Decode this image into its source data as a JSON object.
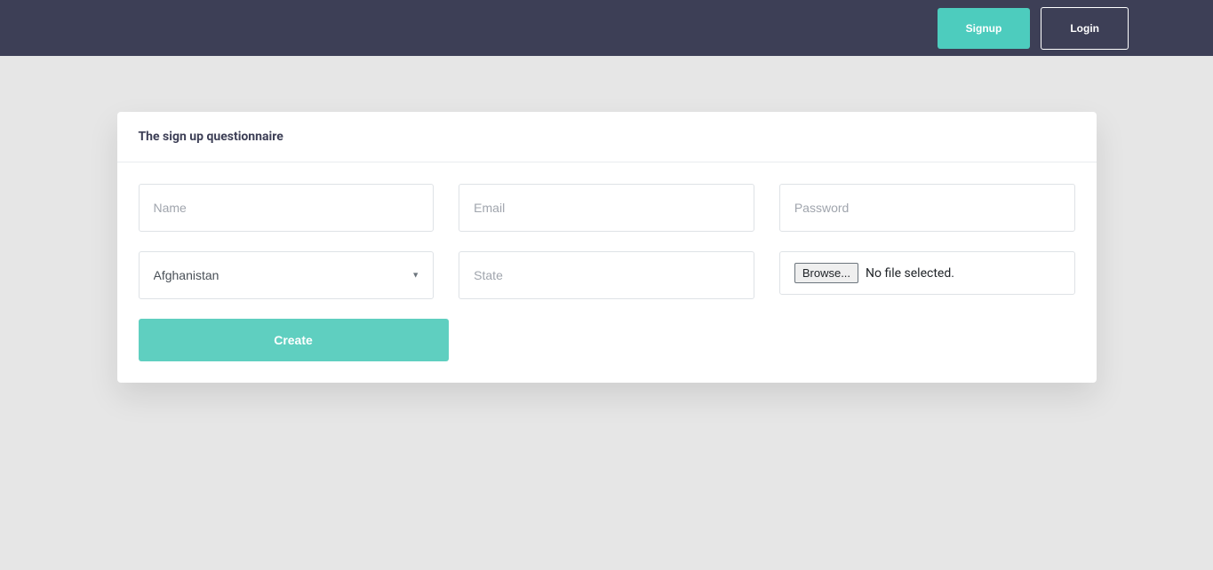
{
  "header": {
    "signup_label": "Signup",
    "login_label": "Login"
  },
  "card": {
    "title": "The sign up questionnaire"
  },
  "form": {
    "name_placeholder": "Name",
    "email_placeholder": "Email",
    "password_placeholder": "Password",
    "country_selected": "Afghanistan",
    "state_placeholder": "State",
    "file_browse_label": "Browse...",
    "file_status": "No file selected.",
    "create_label": "Create"
  }
}
